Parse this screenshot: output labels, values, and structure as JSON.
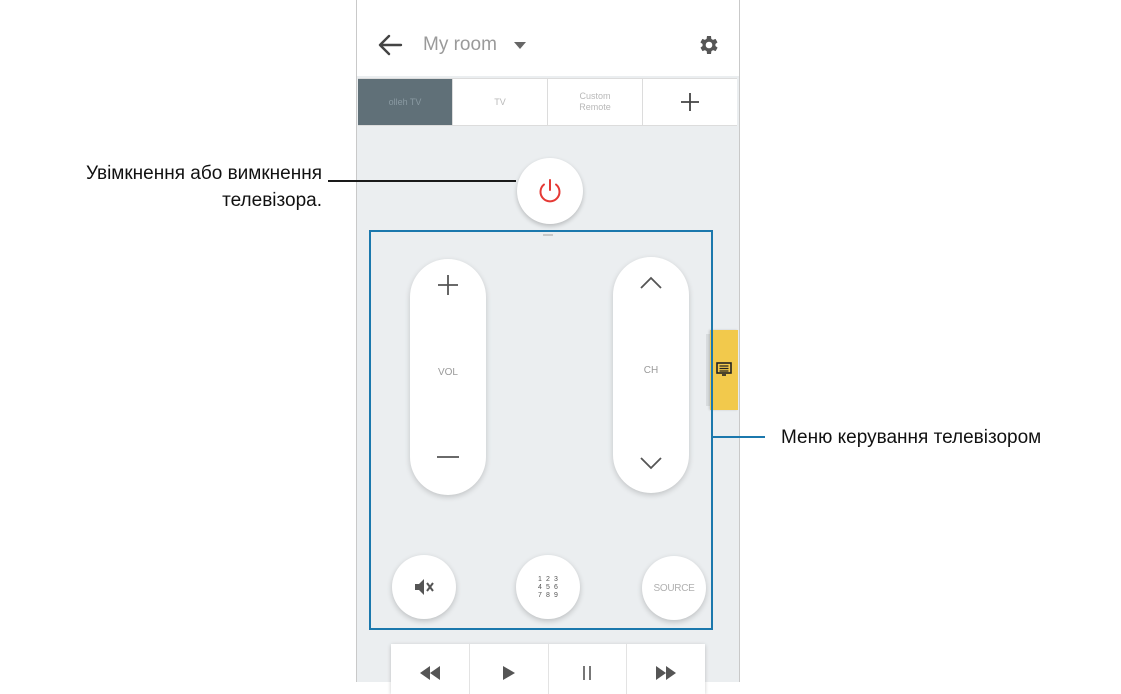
{
  "header": {
    "room_name": "My room"
  },
  "tabs": [
    {
      "label": "olleh TV",
      "active": true
    },
    {
      "label": "TV",
      "active": false
    },
    {
      "label": "Custom\nRemote",
      "active": false
    },
    {
      "label": "+",
      "active": false
    }
  ],
  "remote": {
    "volume_label": "VOL",
    "channel_label": "CH",
    "keypad_digits": [
      "1",
      "2",
      "3",
      "4",
      "5",
      "6",
      "7",
      "8",
      "9"
    ],
    "source_label": "SOURCE"
  },
  "callouts": {
    "power_line1": "Увімкнення або вимкнення",
    "power_line2": "телевізора.",
    "controls": "Меню керування телевізором"
  },
  "colors": {
    "power_icon": "#e53935",
    "highlight": "#1b78ad",
    "side_tab": "#f2c94c",
    "active_tab": "#607078"
  },
  "icons": [
    "back-arrow-icon",
    "dropdown-caret-icon",
    "gear-icon",
    "plus-icon",
    "power-icon",
    "chevron-up-icon",
    "chevron-down-icon",
    "minus-icon",
    "mute-icon",
    "keypad-icon",
    "menu-icon",
    "rewind-icon",
    "play-icon",
    "pause-icon",
    "fast-forward-icon"
  ]
}
